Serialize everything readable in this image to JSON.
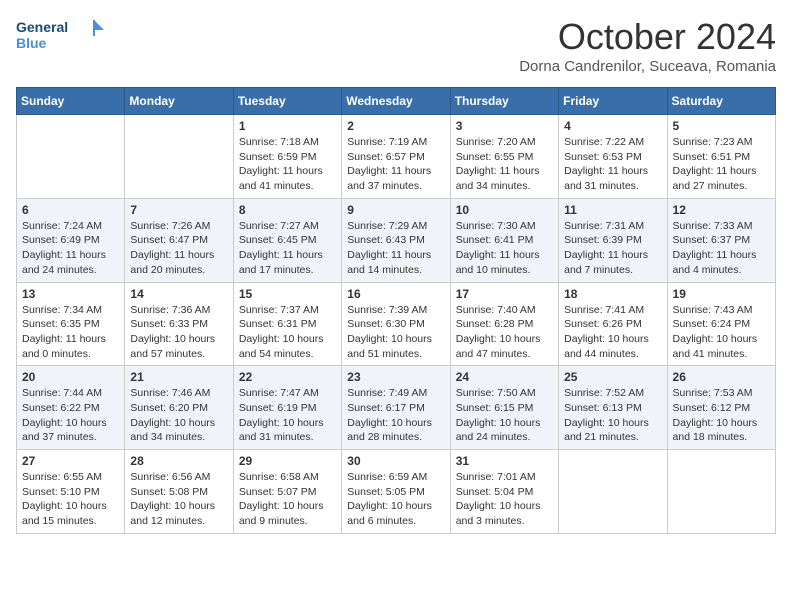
{
  "header": {
    "logo_line1": "General",
    "logo_line2": "Blue",
    "month_title": "October 2024",
    "location": "Dorna Candrenilor, Suceava, Romania"
  },
  "weekdays": [
    "Sunday",
    "Monday",
    "Tuesday",
    "Wednesday",
    "Thursday",
    "Friday",
    "Saturday"
  ],
  "weeks": [
    [
      {
        "day": "",
        "info": ""
      },
      {
        "day": "",
        "info": ""
      },
      {
        "day": "1",
        "info": "Sunrise: 7:18 AM\nSunset: 6:59 PM\nDaylight: 11 hours and 41 minutes."
      },
      {
        "day": "2",
        "info": "Sunrise: 7:19 AM\nSunset: 6:57 PM\nDaylight: 11 hours and 37 minutes."
      },
      {
        "day": "3",
        "info": "Sunrise: 7:20 AM\nSunset: 6:55 PM\nDaylight: 11 hours and 34 minutes."
      },
      {
        "day": "4",
        "info": "Sunrise: 7:22 AM\nSunset: 6:53 PM\nDaylight: 11 hours and 31 minutes."
      },
      {
        "day": "5",
        "info": "Sunrise: 7:23 AM\nSunset: 6:51 PM\nDaylight: 11 hours and 27 minutes."
      }
    ],
    [
      {
        "day": "6",
        "info": "Sunrise: 7:24 AM\nSunset: 6:49 PM\nDaylight: 11 hours and 24 minutes."
      },
      {
        "day": "7",
        "info": "Sunrise: 7:26 AM\nSunset: 6:47 PM\nDaylight: 11 hours and 20 minutes."
      },
      {
        "day": "8",
        "info": "Sunrise: 7:27 AM\nSunset: 6:45 PM\nDaylight: 11 hours and 17 minutes."
      },
      {
        "day": "9",
        "info": "Sunrise: 7:29 AM\nSunset: 6:43 PM\nDaylight: 11 hours and 14 minutes."
      },
      {
        "day": "10",
        "info": "Sunrise: 7:30 AM\nSunset: 6:41 PM\nDaylight: 11 hours and 10 minutes."
      },
      {
        "day": "11",
        "info": "Sunrise: 7:31 AM\nSunset: 6:39 PM\nDaylight: 11 hours and 7 minutes."
      },
      {
        "day": "12",
        "info": "Sunrise: 7:33 AM\nSunset: 6:37 PM\nDaylight: 11 hours and 4 minutes."
      }
    ],
    [
      {
        "day": "13",
        "info": "Sunrise: 7:34 AM\nSunset: 6:35 PM\nDaylight: 11 hours and 0 minutes."
      },
      {
        "day": "14",
        "info": "Sunrise: 7:36 AM\nSunset: 6:33 PM\nDaylight: 10 hours and 57 minutes."
      },
      {
        "day": "15",
        "info": "Sunrise: 7:37 AM\nSunset: 6:31 PM\nDaylight: 10 hours and 54 minutes."
      },
      {
        "day": "16",
        "info": "Sunrise: 7:39 AM\nSunset: 6:30 PM\nDaylight: 10 hours and 51 minutes."
      },
      {
        "day": "17",
        "info": "Sunrise: 7:40 AM\nSunset: 6:28 PM\nDaylight: 10 hours and 47 minutes."
      },
      {
        "day": "18",
        "info": "Sunrise: 7:41 AM\nSunset: 6:26 PM\nDaylight: 10 hours and 44 minutes."
      },
      {
        "day": "19",
        "info": "Sunrise: 7:43 AM\nSunset: 6:24 PM\nDaylight: 10 hours and 41 minutes."
      }
    ],
    [
      {
        "day": "20",
        "info": "Sunrise: 7:44 AM\nSunset: 6:22 PM\nDaylight: 10 hours and 37 minutes."
      },
      {
        "day": "21",
        "info": "Sunrise: 7:46 AM\nSunset: 6:20 PM\nDaylight: 10 hours and 34 minutes."
      },
      {
        "day": "22",
        "info": "Sunrise: 7:47 AM\nSunset: 6:19 PM\nDaylight: 10 hours and 31 minutes."
      },
      {
        "day": "23",
        "info": "Sunrise: 7:49 AM\nSunset: 6:17 PM\nDaylight: 10 hours and 28 minutes."
      },
      {
        "day": "24",
        "info": "Sunrise: 7:50 AM\nSunset: 6:15 PM\nDaylight: 10 hours and 24 minutes."
      },
      {
        "day": "25",
        "info": "Sunrise: 7:52 AM\nSunset: 6:13 PM\nDaylight: 10 hours and 21 minutes."
      },
      {
        "day": "26",
        "info": "Sunrise: 7:53 AM\nSunset: 6:12 PM\nDaylight: 10 hours and 18 minutes."
      }
    ],
    [
      {
        "day": "27",
        "info": "Sunrise: 6:55 AM\nSunset: 5:10 PM\nDaylight: 10 hours and 15 minutes."
      },
      {
        "day": "28",
        "info": "Sunrise: 6:56 AM\nSunset: 5:08 PM\nDaylight: 10 hours and 12 minutes."
      },
      {
        "day": "29",
        "info": "Sunrise: 6:58 AM\nSunset: 5:07 PM\nDaylight: 10 hours and 9 minutes."
      },
      {
        "day": "30",
        "info": "Sunrise: 6:59 AM\nSunset: 5:05 PM\nDaylight: 10 hours and 6 minutes."
      },
      {
        "day": "31",
        "info": "Sunrise: 7:01 AM\nSunset: 5:04 PM\nDaylight: 10 hours and 3 minutes."
      },
      {
        "day": "",
        "info": ""
      },
      {
        "day": "",
        "info": ""
      }
    ]
  ]
}
